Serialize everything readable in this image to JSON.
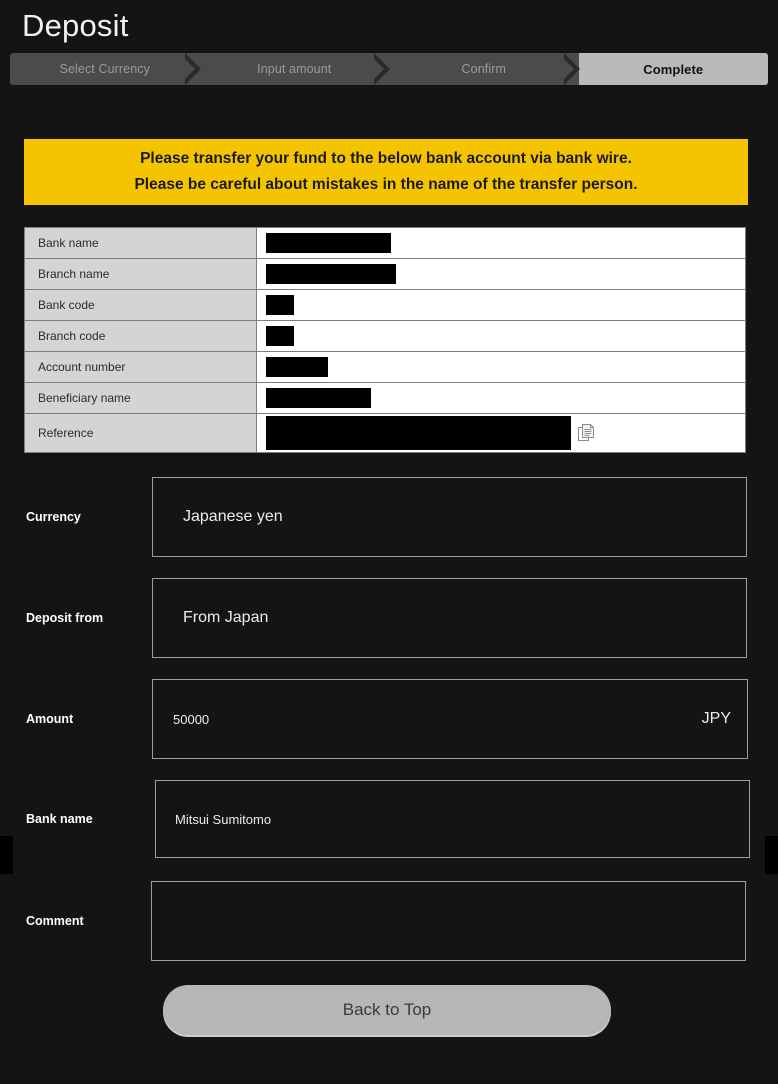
{
  "page": {
    "title": "Deposit",
    "background_color": "#141414"
  },
  "steps": {
    "items": [
      {
        "label": "Select Currency",
        "state": "done"
      },
      {
        "label": "Input amount",
        "state": "done"
      },
      {
        "label": "Confirm",
        "state": "done"
      },
      {
        "label": "Complete",
        "state": "active"
      }
    ],
    "active_color": "#b9b9b9",
    "inactive_color": "#4b4b4b"
  },
  "notice": {
    "line1": "Please transfer your fund to the below bank account via bank wire.",
    "line2": "Please be careful about mistakes in the name of the transfer person.",
    "background_color": "#f5c400",
    "text_color": "#1b1b1b"
  },
  "bank_table": {
    "rows": [
      {
        "label": "Bank name",
        "value": "",
        "redacted": true,
        "redact_width": 125,
        "copy": false
      },
      {
        "label": "Branch name",
        "value": "",
        "redacted": true,
        "redact_width": 130,
        "copy": false
      },
      {
        "label": "Bank code",
        "value": "",
        "redacted": true,
        "redact_width": 28,
        "copy": false
      },
      {
        "label": "Branch code",
        "value": "",
        "redacted": true,
        "redact_width": 28,
        "copy": false
      },
      {
        "label": "Account number",
        "value": "",
        "redacted": true,
        "redact_width": 62,
        "copy": false
      },
      {
        "label": "Beneficiary name",
        "value": "",
        "redacted": true,
        "redact_width": 105,
        "copy": false
      },
      {
        "label": "Reference",
        "value": "",
        "redacted": true,
        "redact_width": 305,
        "copy": true
      }
    ]
  },
  "form": {
    "currency": {
      "label": "Currency",
      "value": "Japanese yen",
      "suffix": ""
    },
    "deposit_from": {
      "label": "Deposit from",
      "value": "From Japan",
      "suffix": ""
    },
    "amount": {
      "label": "Amount",
      "value": "50000",
      "suffix": "JPY"
    },
    "bank_name": {
      "label": "Bank name",
      "value": "Mitsui Sumitomo",
      "suffix": ""
    },
    "comment": {
      "label": "Comment",
      "value": "",
      "suffix": ""
    }
  },
  "actions": {
    "back_to_top": "Back to Top"
  },
  "icons": {
    "copy": "copy-icon"
  }
}
